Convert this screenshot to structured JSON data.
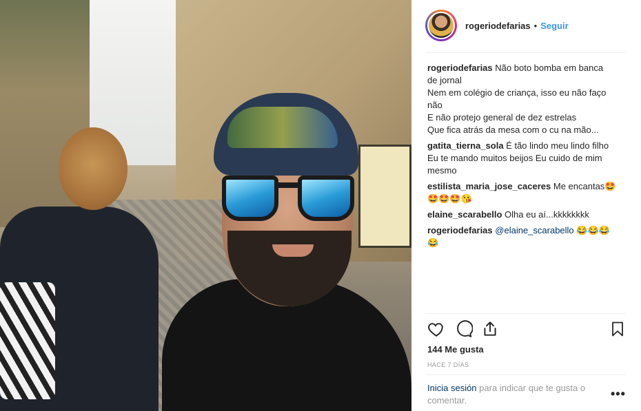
{
  "post": {
    "username": "rogeriodefarias",
    "separator": "•",
    "follow_label": "Seguir",
    "caption": {
      "user": "rogeriodefarias",
      "lines": [
        "Não boto bomba em banca",
        "de jornal",
        "Nem em colégio de criança, isso eu não faço",
        "não",
        "E não protejo general de dez estrelas",
        "Que fica atrás da mesa com o cu na mão..."
      ]
    },
    "comments": [
      {
        "user": "gatita_tierna_sola",
        "lines": [
          "É tão lindo meu lindo filho",
          "Eu te mando muitos beijos Eu cuido de mim",
          "mesmo"
        ]
      },
      {
        "user": "estilista_maria_jose_caceres",
        "lines": [
          "Me encantas🤩",
          "🤩🤩🤩😘"
        ]
      },
      {
        "user": "elaine_scarabello",
        "lines": [
          "Olha eu aí...kkkkkkkk"
        ]
      },
      {
        "user": "rogeriodefarias",
        "mention": "@elaine_scarabello",
        "lines": [
          "😂😂😂",
          "😂"
        ]
      }
    ],
    "likes": "144 Me gusta",
    "time": "HACE 7 DÍAS",
    "login_link": "Inicia sesión",
    "login_text": "para indicar que te gusta o comentar.",
    "more_label": "•••"
  },
  "icons": {
    "like": "heart-icon",
    "comment": "speech-bubble-icon",
    "share": "share-icon",
    "save": "bookmark-icon",
    "more": "more-options-icon"
  },
  "colors": {
    "link_blue": "#3897f0",
    "mention_blue": "#003569",
    "muted_gray": "#999999",
    "text": "#262626"
  }
}
